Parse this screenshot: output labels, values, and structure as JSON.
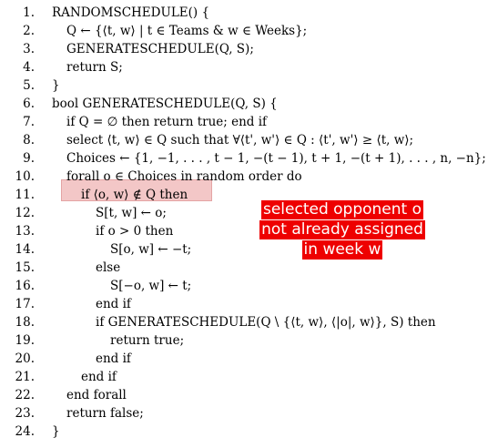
{
  "code_lines": [
    {
      "num": "1.",
      "text": "RANDOMSCHEDULE() {"
    },
    {
      "num": "2.",
      "text": "Q ← {⟨t, w⟩ | t ∈ Teams & w ∈ Weeks};"
    },
    {
      "num": "3.",
      "text": "GENERATESCHEDULE(Q, S);"
    },
    {
      "num": "4.",
      "text": "return S;"
    },
    {
      "num": "5.",
      "text": "}"
    },
    {
      "num": "6.",
      "text": "bool GENERATESCHEDULE(Q, S) {"
    },
    {
      "num": "7.",
      "text": "if Q = ∅ then return true; end if"
    },
    {
      "num": "8.",
      "text": "select ⟨t, w⟩ ∈ Q such that ∀⟨t', w'⟩ ∈ Q : ⟨t', w'⟩ ≥ ⟨t, w⟩;"
    },
    {
      "num": "9.",
      "text": "Choices ← {1, −1, . . . , t − 1, −(t − 1), t + 1, −(t + 1), . . . , n, −n};"
    },
    {
      "num": "10.",
      "text": "forall o ∈ Choices in random order do"
    },
    {
      "num": "11.",
      "text": "if ⟨o, w⟩ ∉ Q then"
    },
    {
      "num": "12.",
      "text": "S[t, w] ← o;"
    },
    {
      "num": "13.",
      "text": "if o > 0 then"
    },
    {
      "num": "14.",
      "text": "S[o, w] ← −t;"
    },
    {
      "num": "15.",
      "text": "else"
    },
    {
      "num": "16.",
      "text": "S[−o, w] ← t;"
    },
    {
      "num": "17.",
      "text": "end if"
    },
    {
      "num": "18.",
      "text": "if GENERATESCHEDULE(Q \\ {⟨t, w⟩, ⟨|o|, w⟩}, S) then"
    },
    {
      "num": "19.",
      "text": "return true;"
    },
    {
      "num": "20.",
      "text": "end if"
    },
    {
      "num": "21.",
      "text": "end if"
    },
    {
      "num": "22.",
      "text": "end forall"
    },
    {
      "num": "23.",
      "text": "return false;"
    },
    {
      "num": "24.",
      "text": "}"
    }
  ],
  "annotation": {
    "line1": "selected opponent o",
    "line2": "not already assigned",
    "line3": "in week w"
  },
  "colors": {
    "highlight": "#f3c7c7",
    "annotation_bg": "#ee0000",
    "annotation_text": "#ffffff"
  }
}
